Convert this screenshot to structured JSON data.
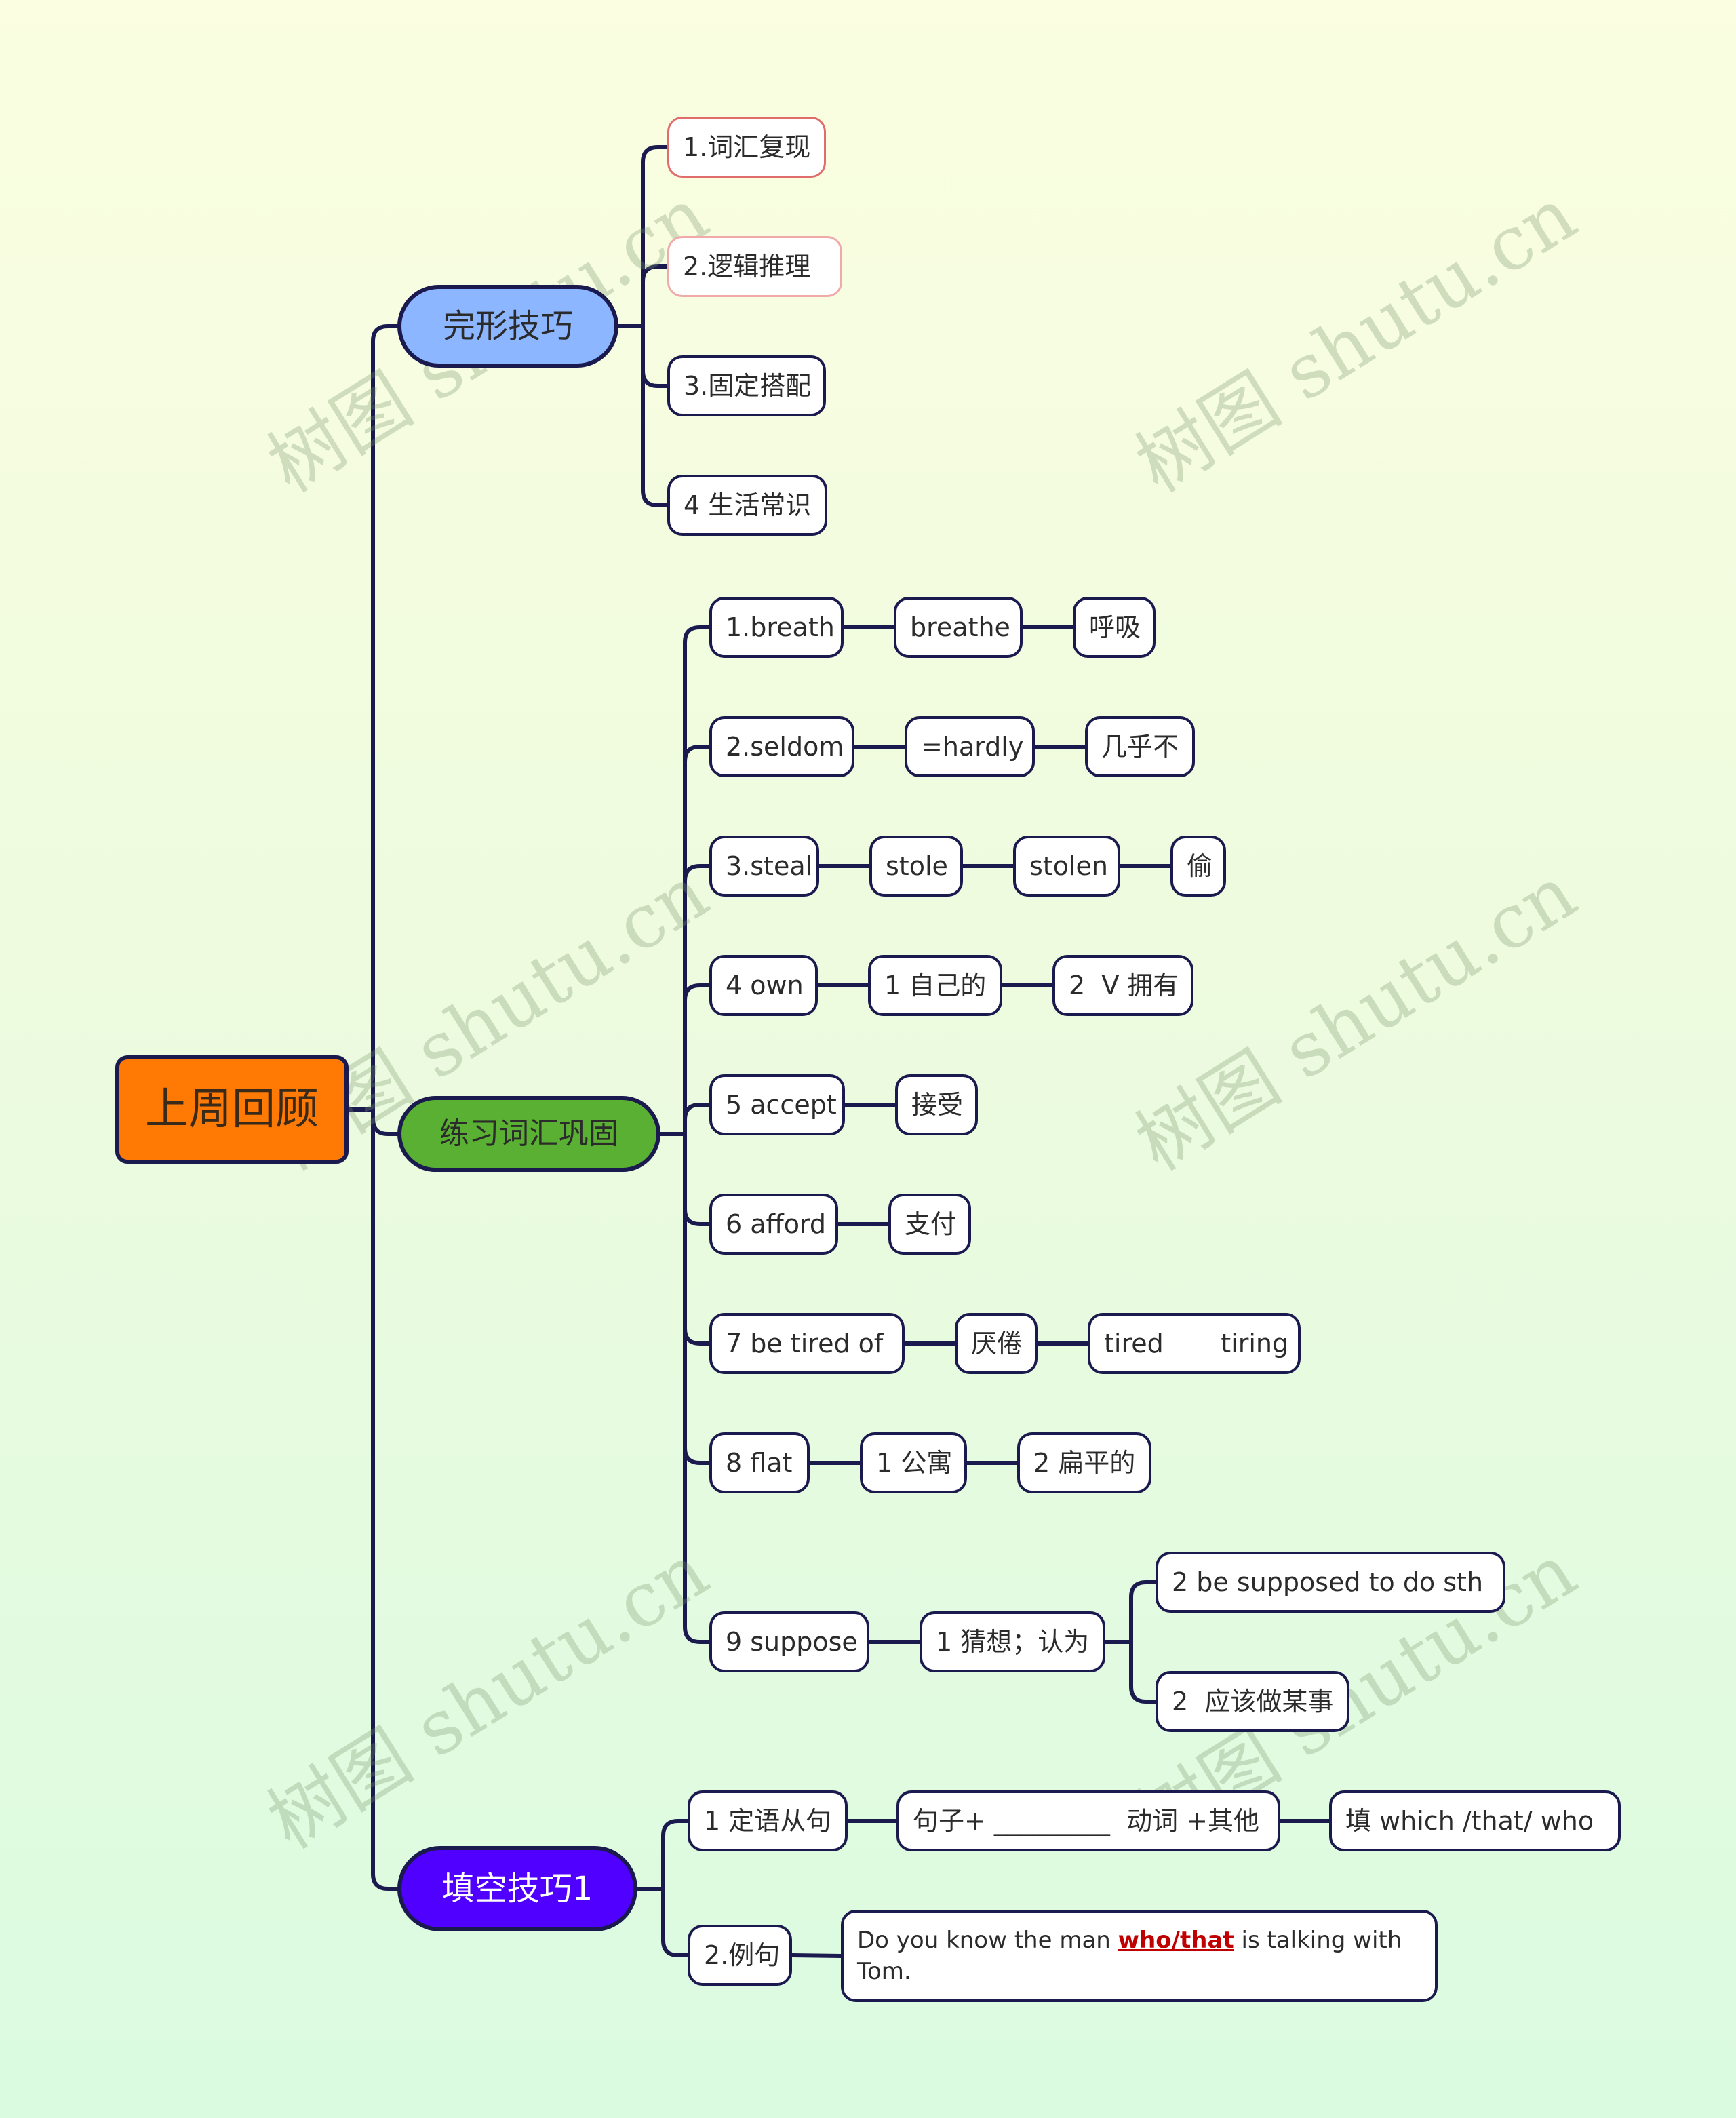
{
  "root": {
    "label": "上周回顾",
    "color": "#ff7a04"
  },
  "branches": [
    {
      "label": "完形技巧",
      "color": "#8cb6ff",
      "children": [
        {
          "label": "1.词汇复现"
        },
        {
          "label": "2.逻辑推理"
        },
        {
          "label": "3.固定搭配"
        },
        {
          "label": "4 生活常识"
        }
      ]
    },
    {
      "label": "练习词汇巩固",
      "color": "#5ab033",
      "rows": [
        [
          "1.breath",
          "breathe",
          "呼吸"
        ],
        [
          "2.seldom",
          "=hardly",
          "几乎不"
        ],
        [
          "3.steal",
          "stole",
          "stolen",
          "偷"
        ],
        [
          "4 own",
          "1 自己的",
          "2  V 拥有"
        ],
        [
          "5 accept",
          "接受"
        ],
        [
          "6 afford",
          "支付"
        ],
        [
          "7 be tired of",
          "厌倦",
          "tired       tiring"
        ],
        [
          "8 flat",
          "1 公寓",
          "2 扁平的"
        ]
      ],
      "suppose": {
        "label": "9 suppose",
        "meaning": "1 猜想；认为",
        "subs": [
          "2 be supposed to do sth",
          "2  应该做某事"
        ]
      }
    },
    {
      "label": "填空技巧1",
      "color": "#5000ff",
      "children": [
        {
          "label": "1 定语从句",
          "pattern": "句子+ _________  动词 +其他",
          "fill": "填 which /that/ who"
        },
        {
          "label": "2.例句",
          "sentence_before": "Do you know the man  ",
          "sentence_highlight": "who/that",
          "sentence_after": " is talking with Tom.",
          "highlight_color": "#c00000"
        }
      ]
    }
  ],
  "watermark": "树图 shutu.cn",
  "connector_color": "#1b1a4f"
}
